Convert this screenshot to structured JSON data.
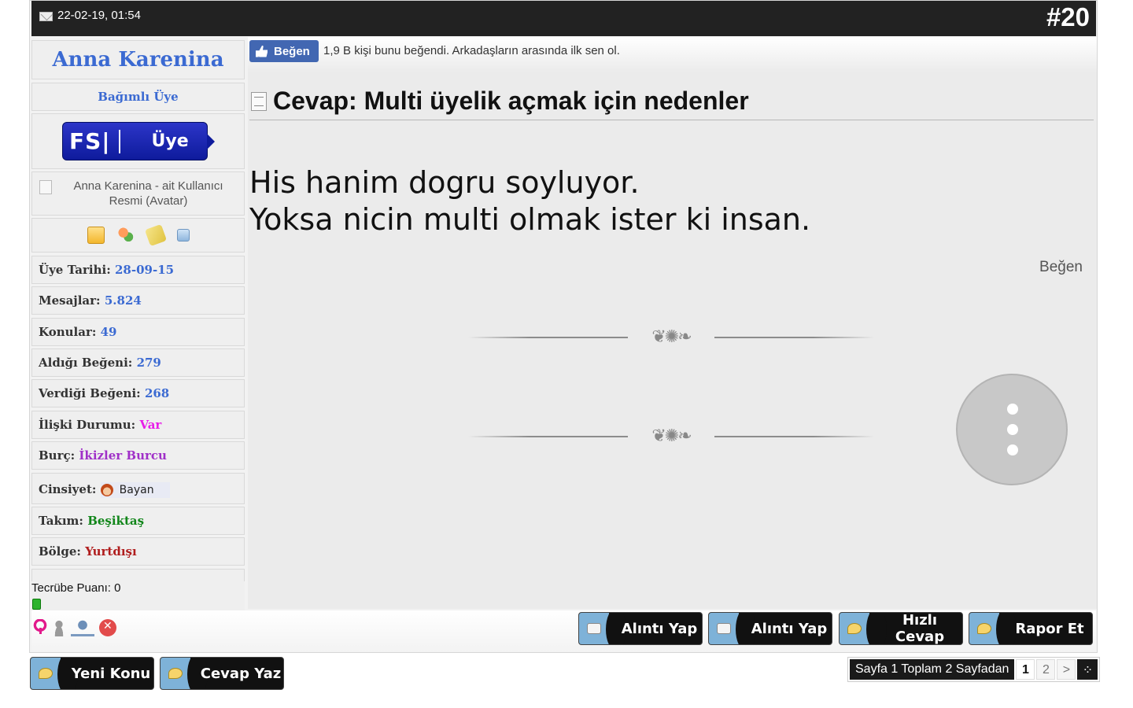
{
  "header": {
    "date": "22-02-19, 01:54",
    "post_number": "#20"
  },
  "sidebar": {
    "username": "Anna Karenina",
    "user_title": "Bağımlı Üye",
    "rank_badge": {
      "abbr": "FS|",
      "label": "Üye"
    },
    "avatar_alt": "Anna Karenina - ait Kullanıcı Resmi (Avatar)",
    "icons": [
      "folder-icon",
      "users-icon",
      "tag-icon",
      "copy-icon"
    ],
    "stats": [
      {
        "label": "Üye Tarihi:",
        "value": "28-09-15"
      },
      {
        "label": "Mesajlar:",
        "value": "5.824"
      },
      {
        "label": "Konular:",
        "value": "49"
      },
      {
        "label": "Aldığı Beğeni:",
        "value": "279"
      },
      {
        "label": "Verdiği Beğeni:",
        "value": "268"
      },
      {
        "label": "İlişki Durumu:",
        "value": "Var"
      },
      {
        "label": "Burç:",
        "value": "İkizler Burcu"
      },
      {
        "label": "Cinsiyet:",
        "value": "Bayan"
      },
      {
        "label": "Takım:",
        "value": "Beşiktaş"
      },
      {
        "label": "Bölge:",
        "value": "Yurtdışı"
      }
    ],
    "experience": "Tecrübe Puanı: 0",
    "footer_icons": [
      "female-icon",
      "user-icon",
      "scale-icon",
      "block-icon"
    ]
  },
  "facebook": {
    "like_button": "Beğen",
    "like_text": "1,9 B kişi bunu beğendi. Arkadaşların arasında ilk sen ol."
  },
  "post": {
    "title": "Cevap: Multi üyelik açmak için nedenler",
    "body_lines": [
      "His hanim dogru soyluyor.",
      "Yoksa nicin multi olmak ister ki insan."
    ],
    "like_link": "Beğen"
  },
  "actions": {
    "quote1": "Alıntı Yap",
    "quote2": "Alıntı Yap",
    "quick_reply": "Hızlı Cevap",
    "report": "Rapor Et"
  },
  "bottom": {
    "new_topic": "Yeni Konu",
    "reply": "Cevap Yaz"
  },
  "pagination": {
    "info": "Sayfa 1 Toplam 2 Sayfadan",
    "pages": [
      "1",
      "2"
    ],
    "current": "1",
    "next": ">"
  },
  "colors": {
    "header_bg": "#222222",
    "username": "#3b6ad2",
    "facebook": "#4267b2",
    "relationship": "#e81ee8",
    "zodiac": "#a030c8",
    "team": "#11861a",
    "region": "#b01e1e"
  }
}
